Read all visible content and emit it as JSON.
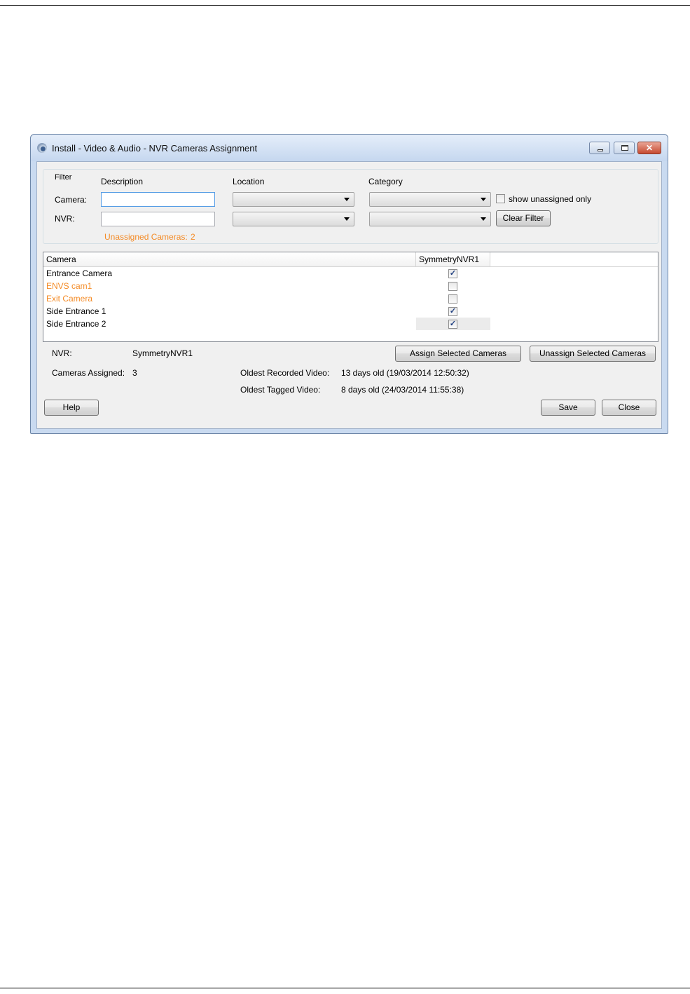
{
  "window": {
    "title": "Install - Video & Audio - NVR Cameras Assignment"
  },
  "filter": {
    "legend": "Filter",
    "col_description": "Description",
    "col_location": "Location",
    "col_category": "Category",
    "camera_label": "Camera:",
    "nvr_label": "NVR:",
    "camera_description_value": "",
    "nvr_description_value": "",
    "camera_location_selected": "",
    "camera_category_selected": "",
    "nvr_location_selected": "",
    "nvr_category_selected": "",
    "show_unassigned_label": "show unassigned only",
    "show_unassigned_checked": false,
    "clear_filter_label": "Clear Filter",
    "unassigned_label": "Unassigned Cameras:",
    "unassigned_count": "2"
  },
  "grid": {
    "columns": [
      "Camera",
      "SymmetryNVR1"
    ],
    "rows": [
      {
        "camera": "Entrance Camera",
        "assigned": true,
        "unassigned": false
      },
      {
        "camera": "ENVS cam1",
        "assigned": false,
        "unassigned": true
      },
      {
        "camera": "Exit Camera",
        "assigned": false,
        "unassigned": true
      },
      {
        "camera": "Side Entrance 1",
        "assigned": true,
        "unassigned": false
      },
      {
        "camera": "Side Entrance 2",
        "assigned": true,
        "unassigned": false
      }
    ],
    "colors": {
      "unassigned_text": "#f48b26"
    }
  },
  "details": {
    "nvr_label": "NVR:",
    "nvr_value": "SymmetryNVR1",
    "assign_label": "Assign Selected Cameras",
    "unassign_label": "Unassign Selected Cameras",
    "cameras_assigned_label": "Cameras Assigned:",
    "cameras_assigned_value": "3",
    "oldest_recorded_label": "Oldest Recorded Video:",
    "oldest_recorded_value": "13 days old (19/03/2014 12:50:32)",
    "oldest_tagged_label": "Oldest Tagged Video:",
    "oldest_tagged_value": "8 days old (24/03/2014 11:55:38)"
  },
  "footer": {
    "help_label": "Help",
    "save_label": "Save",
    "close_label": "Close"
  },
  "icons": {
    "check": "✓",
    "close": "✕"
  }
}
